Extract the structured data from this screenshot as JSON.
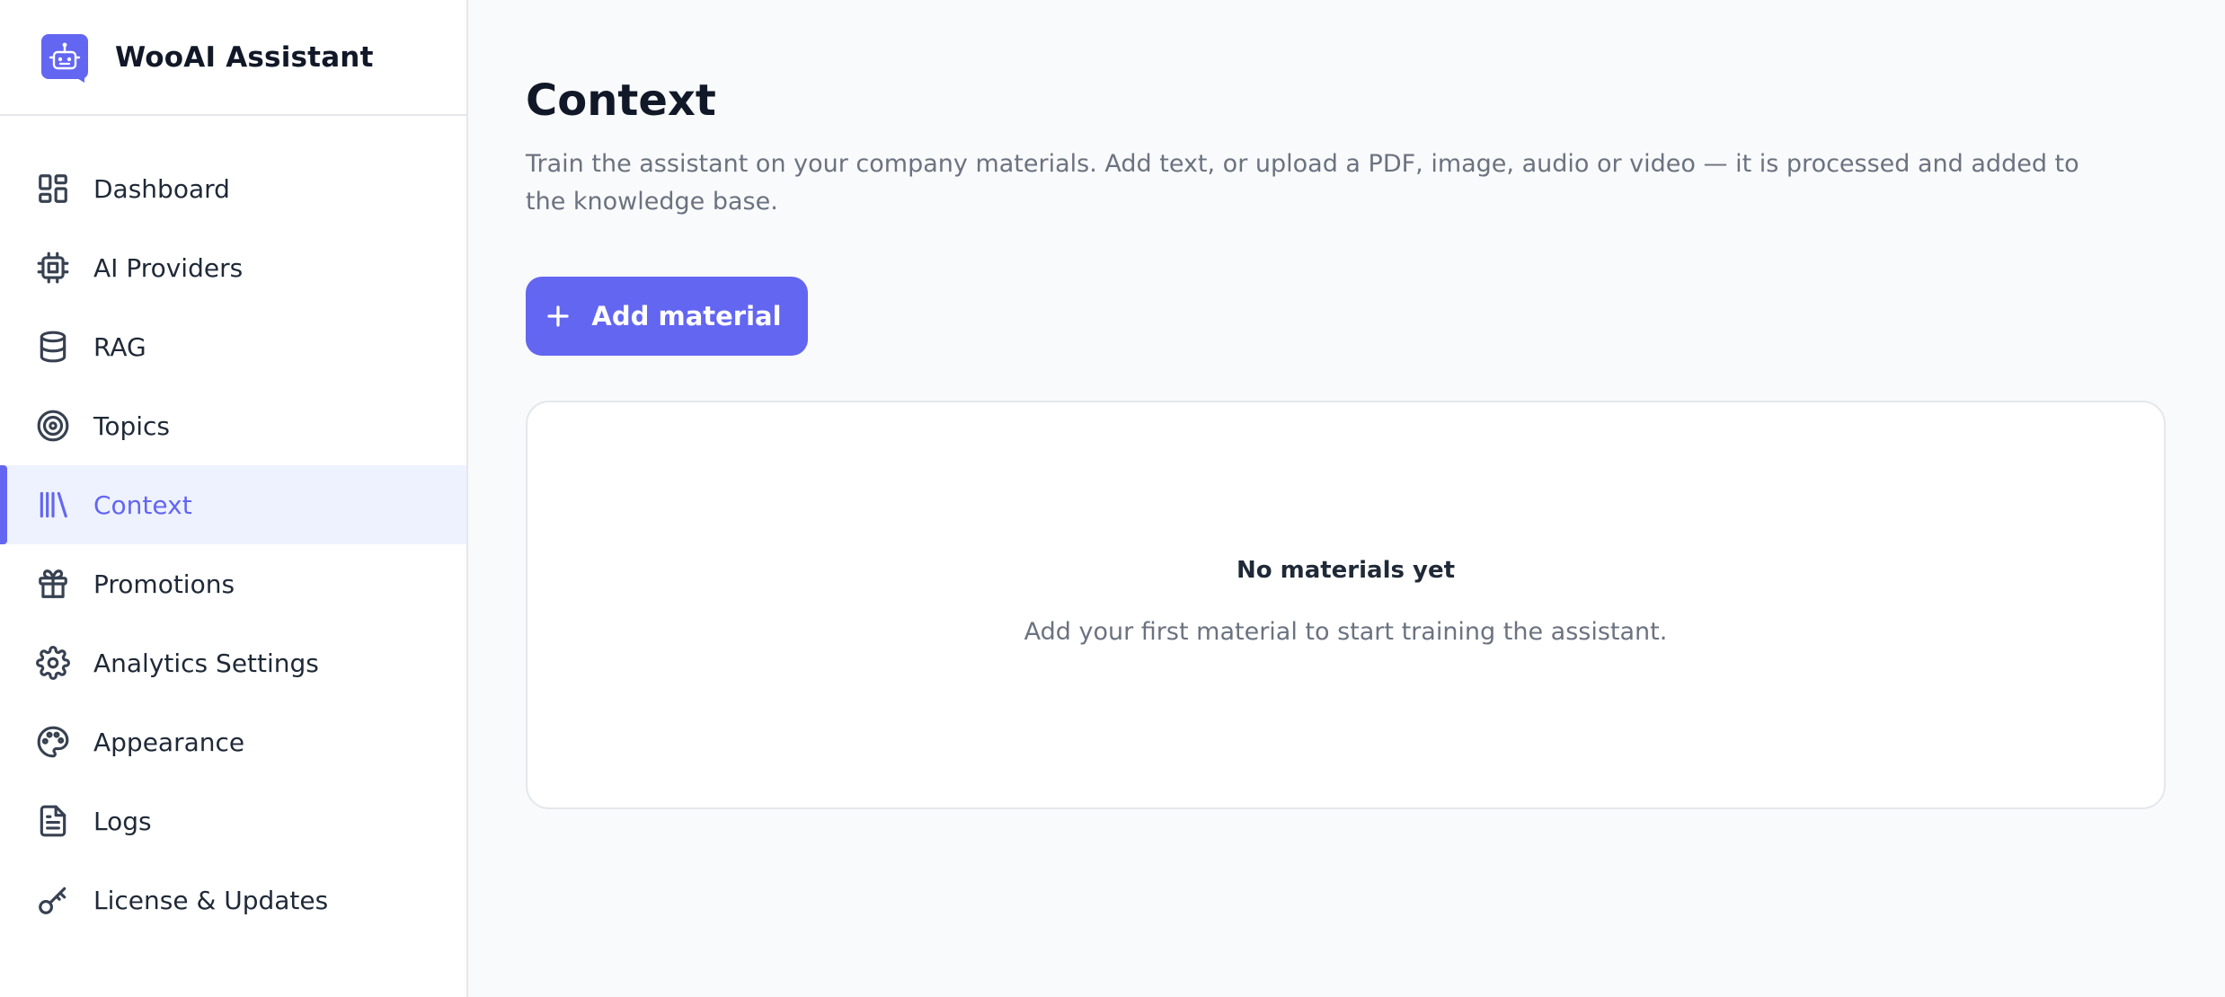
{
  "brand": {
    "title": "WooAI Assistant",
    "logo_icon": "robot-chat-icon",
    "accent_color": "#6366f1"
  },
  "sidebar": {
    "items": [
      {
        "label": "Dashboard",
        "icon": "grid-icon",
        "active": false
      },
      {
        "label": "AI Providers",
        "icon": "cpu-chip-icon",
        "active": false
      },
      {
        "label": "RAG",
        "icon": "database-icon",
        "active": false
      },
      {
        "label": "Topics",
        "icon": "target-icon",
        "active": false
      },
      {
        "label": "Context",
        "icon": "library-icon",
        "active": true
      },
      {
        "label": "Promotions",
        "icon": "gift-icon",
        "active": false
      },
      {
        "label": "Analytics Settings",
        "icon": "gear-icon",
        "active": false
      },
      {
        "label": "Appearance",
        "icon": "palette-icon",
        "active": false
      },
      {
        "label": "Logs",
        "icon": "document-icon",
        "active": false
      },
      {
        "label": "License & Updates",
        "icon": "key-icon",
        "active": false
      }
    ]
  },
  "main": {
    "title": "Context",
    "description": "Train the assistant on your company materials. Add text, or upload a PDF, image, audio or video — it is processed and added to the knowledge base.",
    "add_button_label": "Add material",
    "empty_state": {
      "title": "No materials yet",
      "description": "Add your first material to start training the assistant."
    }
  }
}
